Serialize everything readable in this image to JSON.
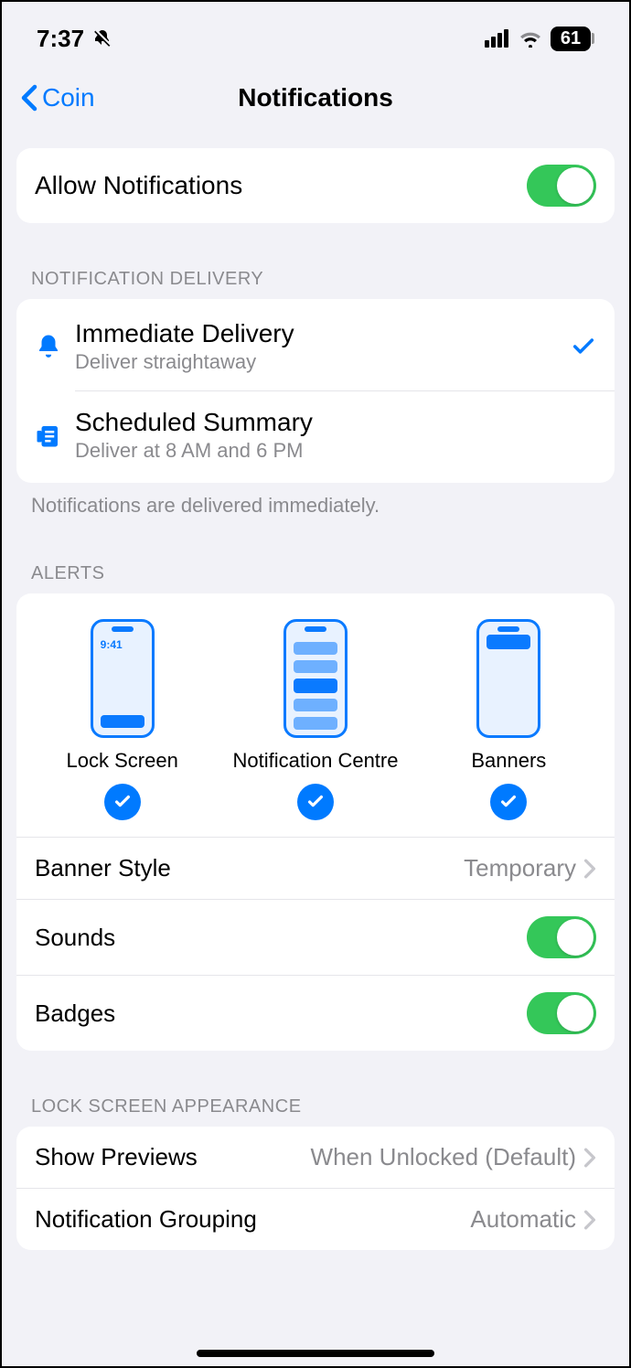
{
  "status": {
    "time": "7:37",
    "silent": true,
    "battery_pct": "61"
  },
  "nav": {
    "back_label": "Coin",
    "title": "Notifications"
  },
  "allow": {
    "label": "Allow Notifications",
    "enabled": true
  },
  "delivery": {
    "header": "NOTIFICATION DELIVERY",
    "options": [
      {
        "title": "Immediate Delivery",
        "sub": "Deliver straightaway",
        "selected": true,
        "icon": "bell-icon"
      },
      {
        "title": "Scheduled Summary",
        "sub": "Deliver at 8 AM and 6 PM",
        "selected": false,
        "icon": "summary-icon"
      }
    ],
    "footer": "Notifications are delivered immediately."
  },
  "alerts": {
    "header": "ALERTS",
    "preview_time": "9:41",
    "options": [
      {
        "label": "Lock Screen",
        "checked": true
      },
      {
        "label": "Notification Centre",
        "checked": true
      },
      {
        "label": "Banners",
        "checked": true
      }
    ],
    "banner_style": {
      "label": "Banner Style",
      "value": "Temporary"
    },
    "sounds": {
      "label": "Sounds",
      "enabled": true
    },
    "badges": {
      "label": "Badges",
      "enabled": true
    }
  },
  "lockscreen": {
    "header": "LOCK SCREEN APPEARANCE",
    "show_previews": {
      "label": "Show Previews",
      "value": "When Unlocked (Default)"
    },
    "grouping": {
      "label": "Notification Grouping",
      "value": "Automatic"
    }
  }
}
